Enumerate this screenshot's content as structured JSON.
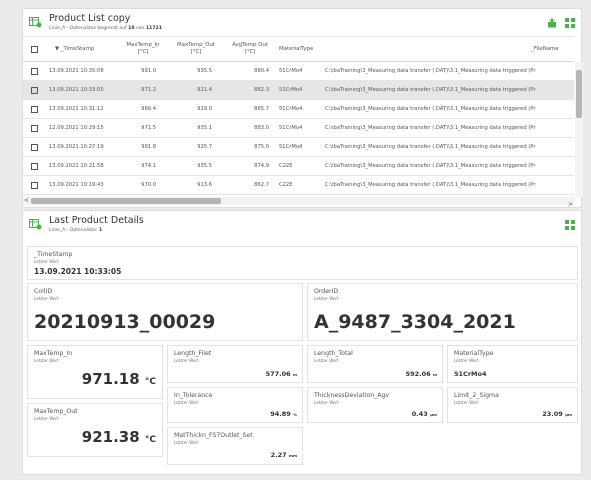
{
  "list_panel": {
    "title": "Product List copy",
    "subtitle_prefix": "Linie_A - Datensätze begrenzt auf",
    "subtitle_limit": "10",
    "subtitle_mid": "von",
    "subtitle_total": "11721",
    "columns": {
      "timestamp": "▼  _TimeStamp",
      "maxin": "MaxTemp_In",
      "maxin_unit": "[°C]",
      "maxout": "MaxTemp_Out",
      "maxout_unit": "[°C]",
      "avgout": "AvgTemp Out",
      "avgout_unit": "[°C]",
      "material": "MaterialType",
      "file": "_FileName"
    },
    "rows": [
      {
        "ts": "13.09.2021 10:35:08",
        "in": "991.0",
        "out": "935.5",
        "avg": "880.4",
        "mat": "51CrMo4",
        "file": "C:\\ibaTraining\\3_Measuring data transfer (.DAT)\\3.1_Measuring data triggered (Pr",
        "selected": false
      },
      {
        "ts": "13.09.2021 10:33:05",
        "in": "971.2",
        "out": "921.4",
        "avg": "882.3",
        "mat": "51CrMo4",
        "file": "C:\\ibaTraining\\3_Measuring data transfer (.DAT)\\3.1_Measuring data triggered (Pr",
        "selected": true
      },
      {
        "ts": "13.09.2021 10:31:12",
        "in": "966.4",
        "out": "919.0",
        "avg": "865.7",
        "mat": "51CrMo4",
        "file": "C:\\ibaTraining\\3_Measuring data transfer (.DAT)\\3.1_Measuring data triggered (Pr",
        "selected": false
      },
      {
        "ts": "12.09.2021 10:29:15",
        "in": "971.5",
        "out": "935.1",
        "avg": "883.0",
        "mat": "51CrMo4",
        "file": "C:\\ibaTraining\\3_Measuring data transfer (.DAT)\\3.1_Measuring data triggered (Pr",
        "selected": false
      },
      {
        "ts": "13.09.2021 10:27:19",
        "in": "991.8",
        "out": "925.7",
        "avg": "875.0",
        "mat": "51CrMo4",
        "file": "C:\\ibaTraining\\3_Measuring data transfer (.DAT)\\3.1_Measuring data triggered (Pr",
        "selected": false
      },
      {
        "ts": "13.09.2021 10:21:58",
        "in": "974.1",
        "out": "935.5",
        "avg": "874.9",
        "mat": "C22E",
        "file": "C:\\ibaTraining\\3_Measuring data transfer (.DAT)\\3.1_Measuring data triggered (Pr",
        "selected": false
      },
      {
        "ts": "13.09.2021 10:19:43",
        "in": "970.0",
        "out": "913.6",
        "avg": "862.7",
        "mat": "C22E",
        "file": "C:\\ibaTraining\\3_Measuring data transfer (.DAT)\\3.1_Measuring data triggered (Pr",
        "selected": false
      }
    ],
    "scroll_left": "<",
    "scroll_right": ">"
  },
  "details_panel": {
    "title": "Last Product Details",
    "subtitle_prefix": "Linie_A - Datensätze:",
    "subtitle_count": "1",
    "latest": "Letzter Wert",
    "timestamp": {
      "label": "_TimeStamp",
      "value": "13.09.2021 10:33:05"
    },
    "coil": {
      "label": "CoilID",
      "value": "20210913_00029"
    },
    "order": {
      "label": "OrderID",
      "value": "A_9487_3304_2021"
    },
    "maxin": {
      "label": "MaxTemp_In",
      "value": "971.18",
      "unit": "°C"
    },
    "maxout": {
      "label": "MaxTemp_Out",
      "value": "921.38",
      "unit": "°C"
    },
    "length_filet": {
      "label": "Length_Filet",
      "value": "577.06",
      "unit": "m"
    },
    "in_tol": {
      "label": "In_Tolerance",
      "value": "94.89",
      "unit": "%"
    },
    "matthick": {
      "label": "MatThickn_FS7Outlet_Set",
      "value": "2.27",
      "unit": "mm"
    },
    "length_total": {
      "label": "Length_Total",
      "value": "592.06",
      "unit": "m"
    },
    "thick_dev": {
      "label": "ThicknessDeviation_Agv",
      "value": "0.43",
      "unit": "µm"
    },
    "material": {
      "label": "MaterialType",
      "value": "51CrMo4"
    },
    "limit": {
      "label": "Limit_2_Sigma",
      "value": "23.09",
      "unit": "µm"
    }
  },
  "colors": {
    "accent": "#4caf50",
    "selected_row": "#e6e6e6",
    "background": "#ebebeb"
  },
  "icons": {
    "panel": "table-icon",
    "export": "export-icon",
    "layout": "grid-icon"
  }
}
